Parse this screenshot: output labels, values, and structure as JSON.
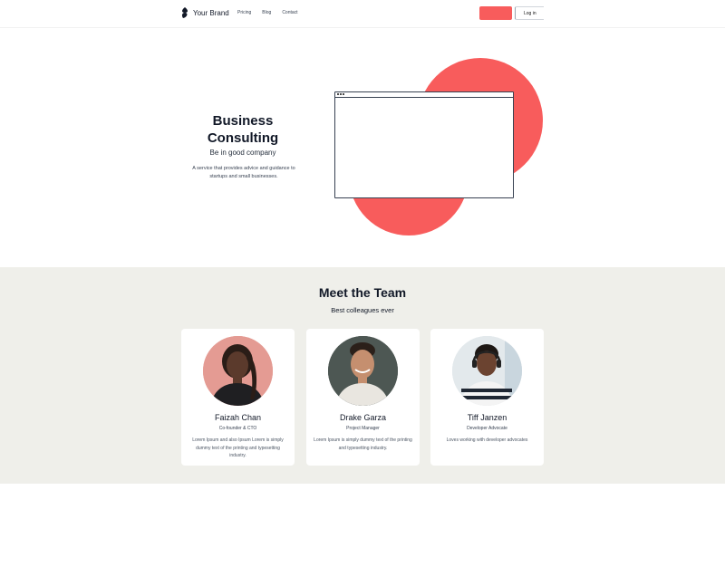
{
  "header": {
    "brand": "Your Brand",
    "nav": [
      "Pricing",
      "Blog",
      "Contact"
    ],
    "cta_label": "",
    "login_label": "Log in"
  },
  "hero": {
    "title": "Business Consulting",
    "subtitle": "Be in good company",
    "description": "A service that provides advice and guidance to startups and small businesses."
  },
  "team": {
    "title": "Meet the Team",
    "subtitle": "Best colleagues ever",
    "members": [
      {
        "name": "Faizah Chan",
        "role": "Co-founder & CTO",
        "bio": "Lorem Ipsum and also Ipsum Lorem is simply dummy text of the printing and typesetting industry."
      },
      {
        "name": "Drake Garza",
        "role": "Project Manager",
        "bio": "Lorem Ipsum is simply dummy text of the printing and typesetting industry."
      },
      {
        "name": "Tiff Janzen",
        "role": "Developer Advocate",
        "bio": "Loves working with developer advocates"
      }
    ]
  },
  "colors": {
    "accent": "#f85c5c",
    "team_bg": "#efefea",
    "text": "#111827"
  }
}
